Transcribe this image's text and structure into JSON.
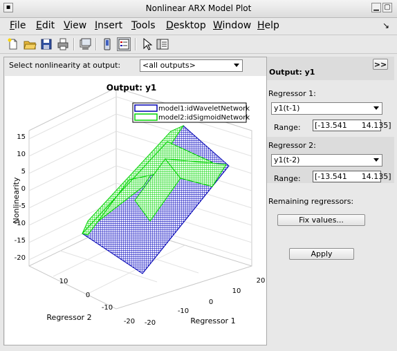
{
  "window": {
    "title": "Nonlinear ARX Model Plot"
  },
  "menu": [
    {
      "label": "File",
      "ul": "F",
      "rest": "ile"
    },
    {
      "label": "Edit",
      "ul": "E",
      "rest": "dit"
    },
    {
      "label": "View",
      "ul": "V",
      "rest": "iew"
    },
    {
      "label": "Insert",
      "ul": "I",
      "rest": "nsert"
    },
    {
      "label": "Tools",
      "ul": "T",
      "rest": "ools"
    },
    {
      "label": "Desktop",
      "ul": "D",
      "rest": "esktop"
    },
    {
      "label": "Window",
      "ul": "W",
      "rest": "indow"
    },
    {
      "label": "Help",
      "ul": "H",
      "rest": "elp"
    }
  ],
  "toolbar": [
    "new-file-icon",
    "open-folder-icon",
    "save-icon",
    "print-icon",
    "print-preview-icon",
    "figure-window-icon",
    "legend-toggle-icon",
    "select-pointer-icon",
    "property-panel-icon"
  ],
  "left": {
    "select_label": "Select nonlinearity at output:",
    "output_combo": "<all outputs>",
    "plot": {
      "title": "Output: y1",
      "zlabel": "Nonlinearity",
      "xlabel": "Regressor 1",
      "ylabel": "Regressor 2",
      "legend": [
        "model1:idWaveletNetwork",
        "model2:idSigmoidNetwork"
      ],
      "zticks": [
        "15",
        "10",
        "5",
        "0",
        "-5",
        "-10",
        "-15",
        "-20"
      ],
      "r1ticks": [
        "-20",
        "-10",
        "0",
        "10",
        "20"
      ],
      "r2ticks": [
        "10",
        "0",
        "-10",
        "-20"
      ],
      "colors": {
        "model1": "#0000b4",
        "model2": "#00d200"
      }
    }
  },
  "right": {
    "output_title": "Output: y1",
    "collapse_button": ">>",
    "reg1": {
      "label": "Regressor 1:",
      "value": "y1(t-1)",
      "range_label": "Range:",
      "range": "[-13.541      14.135]"
    },
    "reg2": {
      "label": "Regressor 2:",
      "value": "y1(t-2)",
      "range_label": "Range:",
      "range": "[-13.541      14.135]"
    },
    "remaining_label": "Remaining regressors:",
    "fix_button": "Fix values...",
    "apply_button": "Apply"
  }
}
